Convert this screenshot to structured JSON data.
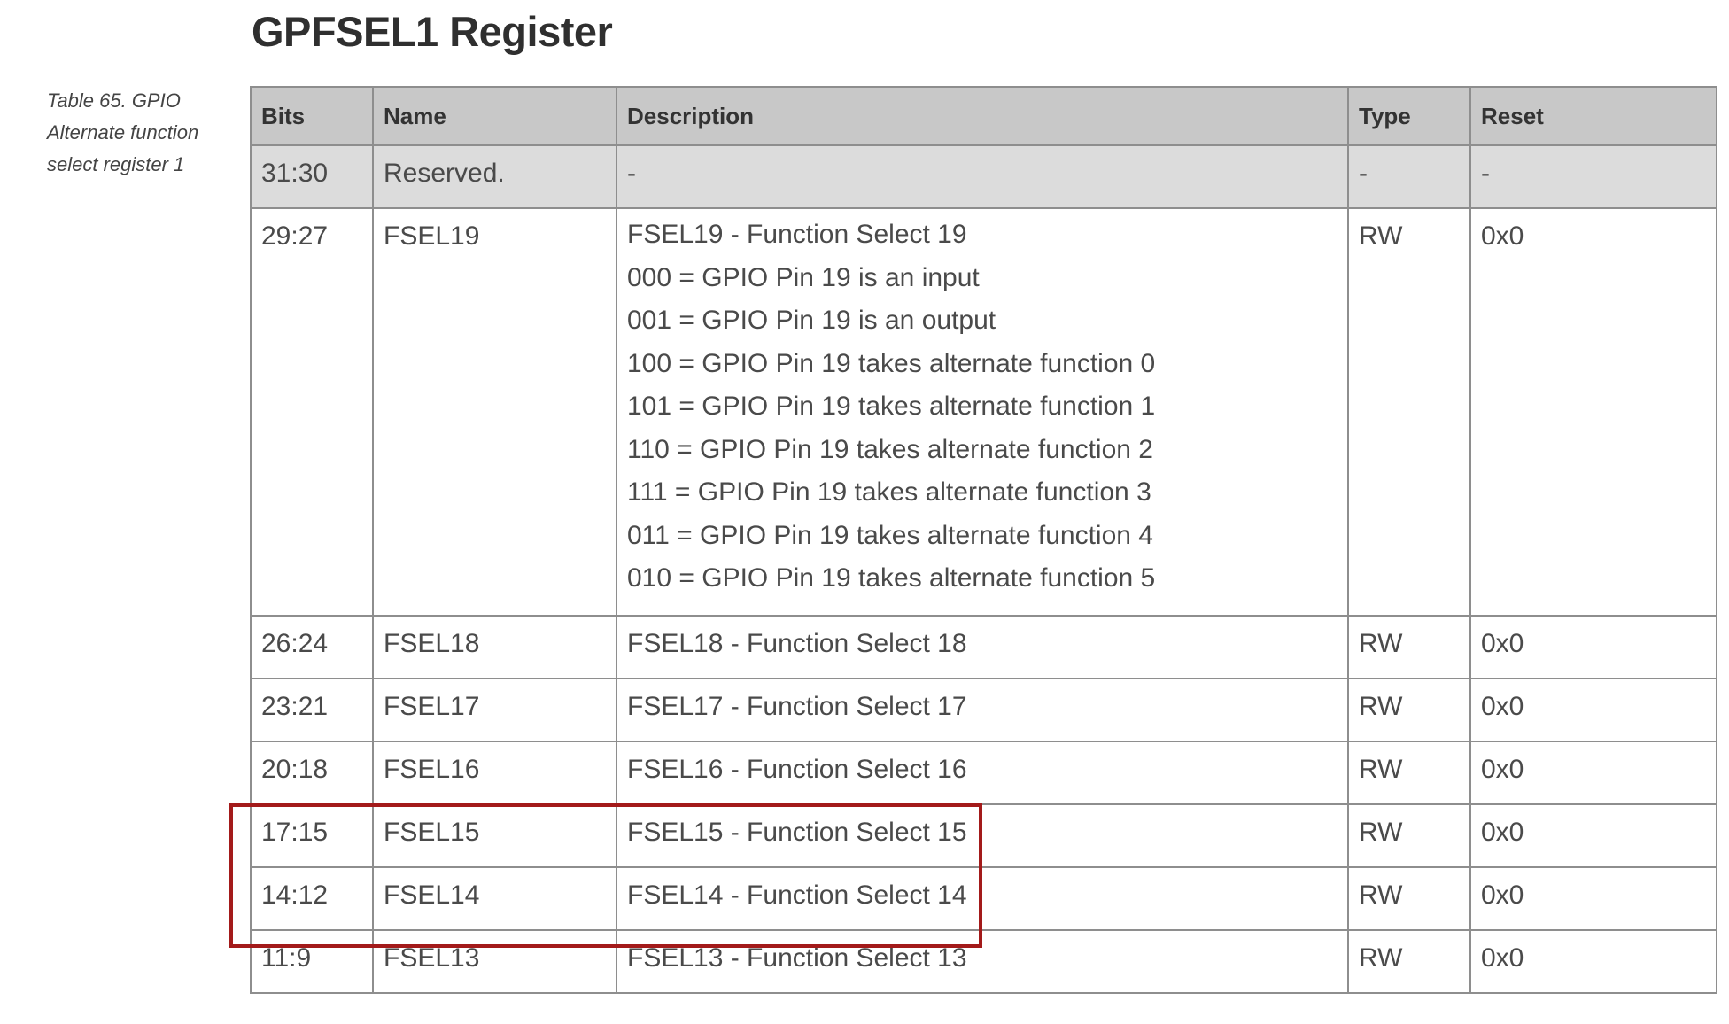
{
  "title": "GPFSEL1 Register",
  "caption": "Table 65. GPIO Alternate function select register 1",
  "columns": [
    "Bits",
    "Name",
    "Description",
    "Type",
    "Reset"
  ],
  "reserved_row": {
    "bits": "31:30",
    "name": "Reserved.",
    "description": "-",
    "type": "-",
    "reset": "-"
  },
  "fsel19": {
    "bits": "29:27",
    "name": "FSEL19",
    "lines": [
      "FSEL19 - Function Select 19",
      "000 = GPIO Pin 19 is an input",
      "001 = GPIO Pin 19 is an output",
      "100 = GPIO Pin 19 takes alternate function 0",
      "101 = GPIO Pin 19 takes alternate function 1",
      "110 = GPIO Pin 19 takes alternate function 2",
      "111 = GPIO Pin 19 takes alternate function 3",
      "011 = GPIO Pin 19 takes alternate function 4",
      "010 = GPIO Pin 19 takes alternate function 5"
    ],
    "type": "RW",
    "reset": "0x0"
  },
  "rows": [
    {
      "bits": "26:24",
      "name": "FSEL18",
      "description": "FSEL18 - Function Select 18",
      "type": "RW",
      "reset": "0x0"
    },
    {
      "bits": "23:21",
      "name": "FSEL17",
      "description": "FSEL17 - Function Select 17",
      "type": "RW",
      "reset": "0x0"
    },
    {
      "bits": "20:18",
      "name": "FSEL16",
      "description": "FSEL16 - Function Select 16",
      "type": "RW",
      "reset": "0x0"
    },
    {
      "bits": "17:15",
      "name": "FSEL15",
      "description": "FSEL15 - Function Select 15",
      "type": "RW",
      "reset": "0x0"
    },
    {
      "bits": "14:12",
      "name": "FSEL14",
      "description": "FSEL14 - Function Select 14",
      "type": "RW",
      "reset": "0x0"
    },
    {
      "bits": "11:9",
      "name": "FSEL13",
      "description": "FSEL13 - Function Select 13",
      "type": "RW",
      "reset": "0x0"
    }
  ],
  "colors": {
    "highlight": "#a31a1a",
    "header_bg": "#c8c8c8",
    "reserved_bg": "#dcdcdc"
  }
}
